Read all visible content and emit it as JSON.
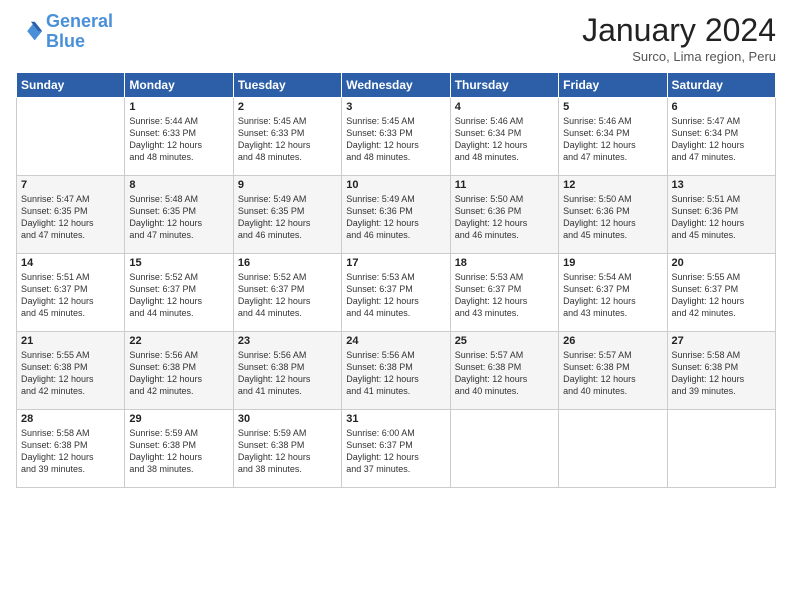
{
  "logo": {
    "line1": "General",
    "line2": "Blue"
  },
  "header": {
    "title": "January 2024",
    "subtitle": "Surco, Lima region, Peru"
  },
  "days_of_week": [
    "Sunday",
    "Monday",
    "Tuesday",
    "Wednesday",
    "Thursday",
    "Friday",
    "Saturday"
  ],
  "weeks": [
    [
      {
        "day": "",
        "content": ""
      },
      {
        "day": "1",
        "content": "Sunrise: 5:44 AM\nSunset: 6:33 PM\nDaylight: 12 hours\nand 48 minutes."
      },
      {
        "day": "2",
        "content": "Sunrise: 5:45 AM\nSunset: 6:33 PM\nDaylight: 12 hours\nand 48 minutes."
      },
      {
        "day": "3",
        "content": "Sunrise: 5:45 AM\nSunset: 6:33 PM\nDaylight: 12 hours\nand 48 minutes."
      },
      {
        "day": "4",
        "content": "Sunrise: 5:46 AM\nSunset: 6:34 PM\nDaylight: 12 hours\nand 48 minutes."
      },
      {
        "day": "5",
        "content": "Sunrise: 5:46 AM\nSunset: 6:34 PM\nDaylight: 12 hours\nand 47 minutes."
      },
      {
        "day": "6",
        "content": "Sunrise: 5:47 AM\nSunset: 6:34 PM\nDaylight: 12 hours\nand 47 minutes."
      }
    ],
    [
      {
        "day": "7",
        "content": "Sunrise: 5:47 AM\nSunset: 6:35 PM\nDaylight: 12 hours\nand 47 minutes."
      },
      {
        "day": "8",
        "content": "Sunrise: 5:48 AM\nSunset: 6:35 PM\nDaylight: 12 hours\nand 47 minutes."
      },
      {
        "day": "9",
        "content": "Sunrise: 5:49 AM\nSunset: 6:35 PM\nDaylight: 12 hours\nand 46 minutes."
      },
      {
        "day": "10",
        "content": "Sunrise: 5:49 AM\nSunset: 6:36 PM\nDaylight: 12 hours\nand 46 minutes."
      },
      {
        "day": "11",
        "content": "Sunrise: 5:50 AM\nSunset: 6:36 PM\nDaylight: 12 hours\nand 46 minutes."
      },
      {
        "day": "12",
        "content": "Sunrise: 5:50 AM\nSunset: 6:36 PM\nDaylight: 12 hours\nand 45 minutes."
      },
      {
        "day": "13",
        "content": "Sunrise: 5:51 AM\nSunset: 6:36 PM\nDaylight: 12 hours\nand 45 minutes."
      }
    ],
    [
      {
        "day": "14",
        "content": "Sunrise: 5:51 AM\nSunset: 6:37 PM\nDaylight: 12 hours\nand 45 minutes."
      },
      {
        "day": "15",
        "content": "Sunrise: 5:52 AM\nSunset: 6:37 PM\nDaylight: 12 hours\nand 44 minutes."
      },
      {
        "day": "16",
        "content": "Sunrise: 5:52 AM\nSunset: 6:37 PM\nDaylight: 12 hours\nand 44 minutes."
      },
      {
        "day": "17",
        "content": "Sunrise: 5:53 AM\nSunset: 6:37 PM\nDaylight: 12 hours\nand 44 minutes."
      },
      {
        "day": "18",
        "content": "Sunrise: 5:53 AM\nSunset: 6:37 PM\nDaylight: 12 hours\nand 43 minutes."
      },
      {
        "day": "19",
        "content": "Sunrise: 5:54 AM\nSunset: 6:37 PM\nDaylight: 12 hours\nand 43 minutes."
      },
      {
        "day": "20",
        "content": "Sunrise: 5:55 AM\nSunset: 6:37 PM\nDaylight: 12 hours\nand 42 minutes."
      }
    ],
    [
      {
        "day": "21",
        "content": "Sunrise: 5:55 AM\nSunset: 6:38 PM\nDaylight: 12 hours\nand 42 minutes."
      },
      {
        "day": "22",
        "content": "Sunrise: 5:56 AM\nSunset: 6:38 PM\nDaylight: 12 hours\nand 42 minutes."
      },
      {
        "day": "23",
        "content": "Sunrise: 5:56 AM\nSunset: 6:38 PM\nDaylight: 12 hours\nand 41 minutes."
      },
      {
        "day": "24",
        "content": "Sunrise: 5:56 AM\nSunset: 6:38 PM\nDaylight: 12 hours\nand 41 minutes."
      },
      {
        "day": "25",
        "content": "Sunrise: 5:57 AM\nSunset: 6:38 PM\nDaylight: 12 hours\nand 40 minutes."
      },
      {
        "day": "26",
        "content": "Sunrise: 5:57 AM\nSunset: 6:38 PM\nDaylight: 12 hours\nand 40 minutes."
      },
      {
        "day": "27",
        "content": "Sunrise: 5:58 AM\nSunset: 6:38 PM\nDaylight: 12 hours\nand 39 minutes."
      }
    ],
    [
      {
        "day": "28",
        "content": "Sunrise: 5:58 AM\nSunset: 6:38 PM\nDaylight: 12 hours\nand 39 minutes."
      },
      {
        "day": "29",
        "content": "Sunrise: 5:59 AM\nSunset: 6:38 PM\nDaylight: 12 hours\nand 38 minutes."
      },
      {
        "day": "30",
        "content": "Sunrise: 5:59 AM\nSunset: 6:38 PM\nDaylight: 12 hours\nand 38 minutes."
      },
      {
        "day": "31",
        "content": "Sunrise: 6:00 AM\nSunset: 6:37 PM\nDaylight: 12 hours\nand 37 minutes."
      },
      {
        "day": "",
        "content": ""
      },
      {
        "day": "",
        "content": ""
      },
      {
        "day": "",
        "content": ""
      }
    ]
  ]
}
